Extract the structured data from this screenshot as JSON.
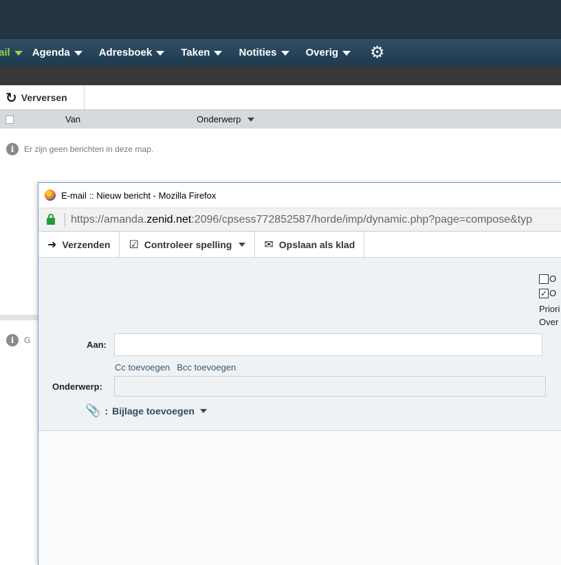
{
  "nav": {
    "items": [
      {
        "label": "ail",
        "active": true
      },
      {
        "label": "Agenda"
      },
      {
        "label": "Adresboek"
      },
      {
        "label": "Taken"
      },
      {
        "label": "Notities"
      },
      {
        "label": "Overig"
      }
    ],
    "settings_icon": "gear-icon"
  },
  "toolbar": {
    "refresh_label": "Verversen",
    "refresh_icon": "refresh-icon"
  },
  "message_list": {
    "columns": {
      "from": "Van",
      "subject": "Onderwerp"
    },
    "empty_text": "Er zijn geen berichten in deze map.",
    "preview_text": "G"
  },
  "popup": {
    "window_title": "E-mail :: Nieuw bericht - Mozilla Firefox",
    "url": {
      "scheme": "https://",
      "subdomain": "amanda.",
      "host": "zenid.net",
      "path": ":2096/cpsess772852587/horde/imp/dynamic.php?page=compose&typ"
    },
    "toolbar": {
      "send_label": "Verzenden",
      "spellcheck_label": "Controleer spelling",
      "save_draft_label": "Opslaan als klad"
    },
    "options": [
      {
        "label": "O",
        "checked": false
      },
      {
        "label": "O",
        "checked": true
      },
      {
        "label": "Priori"
      },
      {
        "label": "Over"
      }
    ],
    "fields": {
      "to_label": "Aan:",
      "to_value": "",
      "add_cc": "Cc toevoegen",
      "add_bcc": "Bcc toevoegen",
      "subject_label": "Onderwerp:",
      "subject_value": "",
      "attach_colon": ":",
      "attach_label": "Bijlage toevoegen"
    }
  },
  "colors": {
    "nav_bg": "#1f3a4d",
    "topbar_bg": "#243544",
    "active_nav": "#8fd14f",
    "popup_border": "#6b9bc7"
  }
}
